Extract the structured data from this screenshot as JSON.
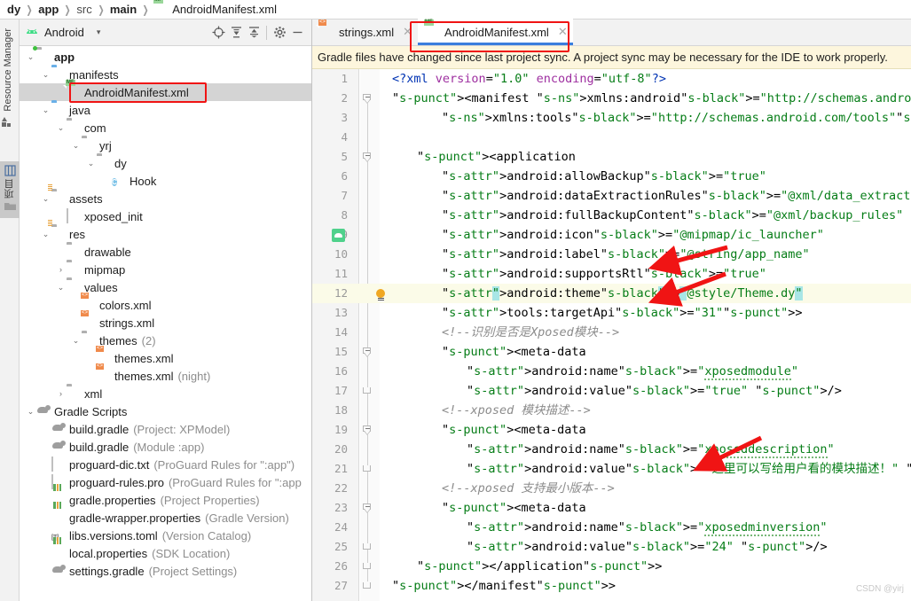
{
  "breadcrumb": {
    "items": [
      "dy",
      "app",
      "src",
      "main"
    ],
    "file": "AndroidManifest.xml",
    "file_icon": "manifest-file-icon"
  },
  "left_strip": {
    "resource_manager": "Resource Manager",
    "project": "项目"
  },
  "project_panel": {
    "toolbar": {
      "title": "Android",
      "caret": "▾",
      "icons": [
        "locate-icon",
        "expand-all-icon",
        "collapse-all-icon",
        "settings-gear-icon",
        "hide-icon"
      ]
    },
    "tree": [
      {
        "indent": 0,
        "arrow": "v",
        "icon": "module-folder-icon",
        "label": "app",
        "bold": true,
        "sub": ""
      },
      {
        "indent": 1,
        "arrow": "v",
        "icon": "folder-blue-icon",
        "label": "manifests",
        "bold": false,
        "sub": ""
      },
      {
        "indent": 2,
        "arrow": "",
        "icon": "manifest-file-icon",
        "label": "AndroidManifest.xml",
        "bold": false,
        "sub": "",
        "selected": true
      },
      {
        "indent": 1,
        "arrow": "v",
        "icon": "folder-blue-icon",
        "label": "java",
        "bold": false,
        "sub": ""
      },
      {
        "indent": 2,
        "arrow": "v",
        "icon": "package-folder-icon",
        "label": "com",
        "bold": false,
        "sub": ""
      },
      {
        "indent": 3,
        "arrow": "v",
        "icon": "package-folder-icon",
        "label": "yrj",
        "bold": false,
        "sub": ""
      },
      {
        "indent": 4,
        "arrow": "v",
        "icon": "package-folder-icon",
        "label": "dy",
        "bold": false,
        "sub": ""
      },
      {
        "indent": 5,
        "arrow": "",
        "icon": "java-class-icon",
        "label": "Hook",
        "bold": false,
        "sub": ""
      },
      {
        "indent": 1,
        "arrow": "v",
        "icon": "res-folder-icon",
        "label": "assets",
        "bold": false,
        "sub": ""
      },
      {
        "indent": 2,
        "arrow": "",
        "icon": "text-file-icon",
        "label": "xposed_init",
        "bold": false,
        "sub": ""
      },
      {
        "indent": 1,
        "arrow": "v",
        "icon": "res-folder-icon",
        "label": "res",
        "bold": false,
        "sub": ""
      },
      {
        "indent": 2,
        "arrow": "",
        "icon": "package-folder-icon",
        "label": "drawable",
        "bold": false,
        "sub": ""
      },
      {
        "indent": 2,
        "arrow": ">",
        "icon": "package-folder-icon",
        "label": "mipmap",
        "bold": false,
        "sub": ""
      },
      {
        "indent": 2,
        "arrow": "v",
        "icon": "package-folder-icon",
        "label": "values",
        "bold": false,
        "sub": ""
      },
      {
        "indent": 3,
        "arrow": "",
        "icon": "xml-file-icon",
        "label": "colors.xml",
        "bold": false,
        "sub": ""
      },
      {
        "indent": 3,
        "arrow": "",
        "icon": "xml-file-icon",
        "label": "strings.xml",
        "bold": false,
        "sub": ""
      },
      {
        "indent": 3,
        "arrow": "v",
        "icon": "package-folder-icon",
        "label": "themes",
        "bold": false,
        "sub": "(2)"
      },
      {
        "indent": 4,
        "arrow": "",
        "icon": "xml-file-icon",
        "label": "themes.xml",
        "bold": false,
        "sub": ""
      },
      {
        "indent": 4,
        "arrow": "",
        "icon": "xml-file-icon",
        "label": "themes.xml",
        "bold": false,
        "sub": "(night)"
      },
      {
        "indent": 2,
        "arrow": ">",
        "icon": "package-folder-icon",
        "label": "xml",
        "bold": false,
        "sub": ""
      },
      {
        "indent": 0,
        "arrow": "v",
        "icon": "gradle-icon",
        "label": "Gradle Scripts",
        "bold": false,
        "sub": ""
      },
      {
        "indent": 1,
        "arrow": "",
        "icon": "gradle-icon",
        "label": "build.gradle",
        "bold": false,
        "sub": "(Project: XPModel)"
      },
      {
        "indent": 1,
        "arrow": "",
        "icon": "gradle-icon",
        "label": "build.gradle",
        "bold": false,
        "sub": "(Module :app)"
      },
      {
        "indent": 1,
        "arrow": "",
        "icon": "text-file-icon",
        "label": "proguard-dic.txt",
        "bold": false,
        "sub": "(ProGuard Rules for \":app\")"
      },
      {
        "indent": 1,
        "arrow": "",
        "icon": "text-file-icon",
        "label": "proguard-rules.pro",
        "bold": false,
        "sub": "(ProGuard Rules for \":app"
      },
      {
        "indent": 1,
        "arrow": "",
        "icon": "properties-file-icon",
        "label": "gradle.properties",
        "bold": false,
        "sub": "(Project Properties)"
      },
      {
        "indent": 1,
        "arrow": "",
        "icon": "properties-file-icon",
        "label": "gradle-wrapper.properties",
        "bold": false,
        "sub": "(Gradle Version)"
      },
      {
        "indent": 1,
        "arrow": "",
        "icon": "toml-file-icon",
        "label": "libs.versions.toml",
        "bold": false,
        "sub": "(Version Catalog)"
      },
      {
        "indent": 1,
        "arrow": "",
        "icon": "properties-file-icon",
        "label": "local.properties",
        "bold": false,
        "sub": "(SDK Location)"
      },
      {
        "indent": 1,
        "arrow": "",
        "icon": "gradle-icon",
        "label": "settings.gradle",
        "bold": false,
        "sub": "(Project Settings)"
      }
    ]
  },
  "editor": {
    "tabs": [
      {
        "label": "strings.xml",
        "icon": "xml-file-icon",
        "active": false,
        "close": "✕"
      },
      {
        "label": "AndroidManifest.xml",
        "icon": "manifest-file-icon",
        "active": true,
        "close": "✕"
      }
    ],
    "notice": "Gradle files have changed since last project sync. A project sync may be necessary for the IDE to work properly.",
    "gutter_icons": {
      "line9": "android-resource-preview-icon",
      "line12": "intention-bulb-icon"
    },
    "first_line": 1,
    "last_line": 27,
    "lines": [
      {
        "n": 1,
        "indent": 0,
        "text": "<?xml version=\"1.0\" encoding=\"utf-8\"?>"
      },
      {
        "n": 2,
        "indent": 0,
        "text": "<manifest xmlns:android=\"http://schemas.android.com/apk/res/android\""
      },
      {
        "n": 3,
        "indent": 2,
        "text": "xmlns:tools=\"http://schemas.android.com/tools\">"
      },
      {
        "n": 4,
        "indent": 0,
        "text": ""
      },
      {
        "n": 5,
        "indent": 1,
        "text": "<application"
      },
      {
        "n": 6,
        "indent": 2,
        "text": "android:allowBackup=\"true\""
      },
      {
        "n": 7,
        "indent": 2,
        "text": "android:dataExtractionRules=\"@xml/data_extraction_rules\""
      },
      {
        "n": 8,
        "indent": 2,
        "text": "android:fullBackupContent=\"@xml/backup_rules\""
      },
      {
        "n": 9,
        "indent": 2,
        "text": "android:icon=\"@mipmap/ic_launcher\""
      },
      {
        "n": 10,
        "indent": 2,
        "text": "android:label=\"@string/app_name\""
      },
      {
        "n": 11,
        "indent": 2,
        "text": "android:supportsRtl=\"true\""
      },
      {
        "n": 12,
        "indent": 2,
        "text": "android:theme=\"@style/Theme.dy\"",
        "highlight": true
      },
      {
        "n": 13,
        "indent": 2,
        "text": "tools:targetApi=\"31\">"
      },
      {
        "n": 14,
        "indent": 2,
        "text": "<!--识别是否是Xposed模块-->"
      },
      {
        "n": 15,
        "indent": 2,
        "text": "<meta-data"
      },
      {
        "n": 16,
        "indent": 3,
        "text": "android:name=\"xposedmodule\""
      },
      {
        "n": 17,
        "indent": 3,
        "text": "android:value=\"true\" />"
      },
      {
        "n": 18,
        "indent": 2,
        "text": "<!--xposed 模块描述-->"
      },
      {
        "n": 19,
        "indent": 2,
        "text": "<meta-data"
      },
      {
        "n": 20,
        "indent": 3,
        "text": "android:name=\"xposeddescription\""
      },
      {
        "n": 21,
        "indent": 3,
        "text": "android:value=\"这里可以写给用户看的模块描述！\" />"
      },
      {
        "n": 22,
        "indent": 2,
        "text": "<!--xposed 支持最小版本-->"
      },
      {
        "n": 23,
        "indent": 2,
        "text": "<meta-data"
      },
      {
        "n": 24,
        "indent": 3,
        "text": "android:name=\"xposedminversion\""
      },
      {
        "n": 25,
        "indent": 3,
        "text": "android:value=\"24\" />"
      },
      {
        "n": 26,
        "indent": 1,
        "text": "</application>"
      },
      {
        "n": 27,
        "indent": 0,
        "text": "</manifest>"
      }
    ]
  },
  "annotations": {
    "highlight_color": "#f01414",
    "selection_color": "#a8e6e6",
    "boxes": [
      "tree-manifest-highlight",
      "tab-manifest-highlight"
    ],
    "arrows": [
      "arrow-to-app-name",
      "arrow-to-theme-dy",
      "arrow-to-module-description"
    ]
  },
  "watermark": "CSDN @yirj"
}
